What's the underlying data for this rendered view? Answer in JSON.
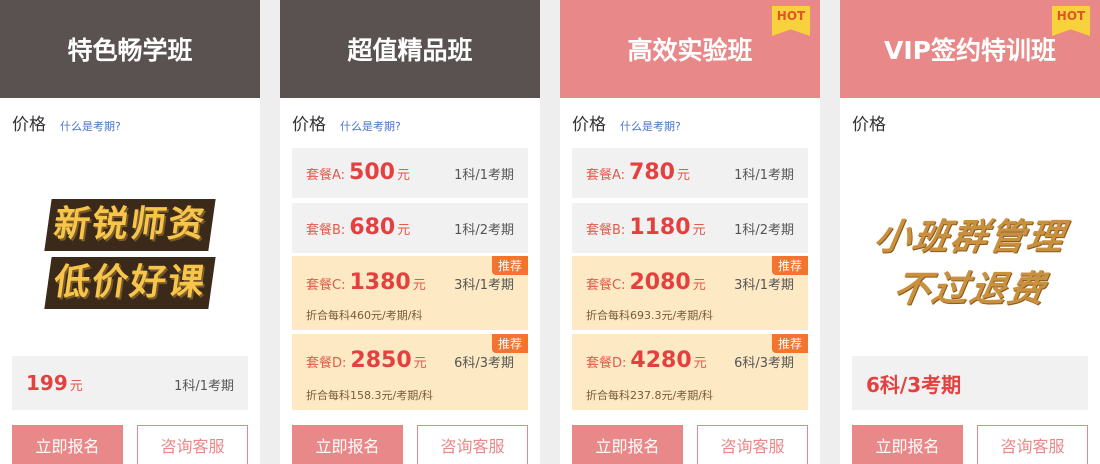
{
  "cards": [
    {
      "title": "特色畅学班",
      "price_label": "价格",
      "price_link": "什么是考期?",
      "promo": [
        "新锐师资",
        "低价好课"
      ],
      "total": {
        "price": "199",
        "unit": "元",
        "meta": "1科/1考期"
      },
      "buttons": {
        "enroll": "立即报名",
        "consult": "咨询客服"
      }
    },
    {
      "title": "超值精品班",
      "price_label": "价格",
      "price_link": "什么是考期?",
      "packages": [
        {
          "name": "套餐A:",
          "price": "500",
          "unit": "元",
          "meta": "1科/1考期"
        },
        {
          "name": "套餐B:",
          "price": "680",
          "unit": "元",
          "meta": "1科/2考期"
        },
        {
          "name": "套餐C:",
          "price": "1380",
          "unit": "元",
          "meta": "3科/1考期",
          "tag": "推荐",
          "sub": "折合每科460元/考期/科"
        },
        {
          "name": "套餐D:",
          "price": "2850",
          "unit": "元",
          "meta": "6科/3考期",
          "tag": "推荐",
          "sub": "折合每科158.3元/考期/科"
        }
      ],
      "buttons": {
        "enroll": "立即报名",
        "consult": "咨询客服"
      }
    },
    {
      "title": "高效实验班",
      "hot": "HOT",
      "price_label": "价格",
      "price_link": "什么是考期?",
      "packages": [
        {
          "name": "套餐A:",
          "price": "780",
          "unit": "元",
          "meta": "1科/1考期"
        },
        {
          "name": "套餐B:",
          "price": "1180",
          "unit": "元",
          "meta": "1科/2考期"
        },
        {
          "name": "套餐C:",
          "price": "2080",
          "unit": "元",
          "meta": "3科/1考期",
          "tag": "推荐",
          "sub": "折合每科693.3元/考期/科"
        },
        {
          "name": "套餐D:",
          "price": "4280",
          "unit": "元",
          "meta": "6科/3考期",
          "tag": "推荐",
          "sub": "折合每科237.8元/考期/科"
        }
      ],
      "buttons": {
        "enroll": "立即报名",
        "consult": "咨询客服"
      }
    },
    {
      "title": "VIP签约特训班",
      "hot": "HOT",
      "price_label": "价格",
      "promo": [
        "小班群管理",
        "不过退费"
      ],
      "total": {
        "big": "6科/3考期"
      },
      "buttons": {
        "enroll": "立即报名",
        "consult": "咨询客服"
      }
    }
  ],
  "colors": {
    "header_dark": "#5a5250",
    "header_pink": "#e98888",
    "accent_red": "#e54040",
    "recommend_bg": "#fde9c4",
    "tag_orange": "#f4732f"
  }
}
